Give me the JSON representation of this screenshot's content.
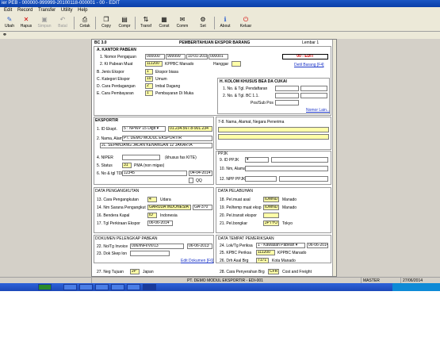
{
  "window": {
    "title": "ier PEB - 000000-999999-20100118-000001 - 00 - EDIT"
  },
  "menu": [
    "Edit",
    "Record",
    "Transfer",
    "Utility",
    "Help"
  ],
  "toolbar": [
    {
      "label": "Ubah",
      "icon": "✎"
    },
    {
      "label": "Hapus",
      "icon": "✕"
    },
    {
      "label": "Simpan",
      "icon": "▣"
    },
    {
      "label": "Batal",
      "icon": "↶"
    },
    {
      "label": "Cetak",
      "icon": "⎙"
    },
    {
      "label": "Copy",
      "icon": "❐"
    },
    {
      "label": "Compr",
      "icon": "▤"
    },
    {
      "label": "Transf",
      "icon": "⇅"
    },
    {
      "label": "Const",
      "icon": "▦"
    },
    {
      "label": "Comm",
      "icon": "✉"
    },
    {
      "label": "Set",
      "icon": "⚙"
    },
    {
      "label": "About",
      "icon": "ℹ"
    },
    {
      "label": "Keluar",
      "icon": "⏻"
    }
  ],
  "form": {
    "code": "BC 3.0",
    "header_title": "PEMBERITAHUAN EKSPOR BARANG",
    "sheet_label": "Lembar 1",
    "status": "00 - EDIT",
    "kantor_title": "A. KANTOR PABEAN",
    "nomor_label": "1. Nomor Pengajuan",
    "nomor": [
      "000000",
      "999999",
      "10-01-2010",
      "000001"
    ],
    "kantor_muat_label": "2. Kt Pabean Muat",
    "kantor_muat_code": "111200",
    "kantor_muat_name": "KPPBC Manado",
    "hanggar_label": "Hanggar",
    "detil_barang": "Detil Barang [F4]",
    "jenis_label": "B. Jenis Ekspor",
    "jenis_code": "1",
    "jenis_name": "Ekspor biasa",
    "kategori_label": "C. Kategori Ekspor",
    "kategori_code": "10",
    "kategori_name": "Umum",
    "perdagangan_label": "D. Cara Perdagangan",
    "perdagangan_code": "2",
    "perdagangan_name": "Imbal Dagang",
    "pembayaran_label": "E. Cara Pembayaran",
    "pembayaran_code": "1",
    "pembayaran_name": "Pembayaran Di Muka",
    "kolom_title": "H. KOLOM KHUSUS BEA DA CUKAI",
    "kolom_1": "1. No. & Tgl. Pendaftaran",
    "kolom_2": "2. No. & Tgl. BC 1.1.",
    "kolom_3": "Pos/Sub Pos",
    "nomor_lain": "Nomor Lain...",
    "eksportir_title": "EKSPORTIR",
    "id_label": "1. ID Ekspt.",
    "id_type": "5 : NPWP 15 Digit",
    "id_value": "01.234.567.8-901.234",
    "nama_label": "2. Nama, Alamat",
    "nama_value": "PT. DEMO MODUL EKSPORTIR",
    "alamat_value": "JL. SEPANJANG JALAN KENANGAN 12 JAKARTA",
    "nipier_label": "4. NIPER",
    "nipier_hint": "(khusus fas KITE)",
    "status_label": "5. Status",
    "status_code": "31",
    "status_name": "PMA (non migas)",
    "tdp_label": "6. No & tgl TDP",
    "tdp_value": "12345",
    "tdp_date": "04-04-2014",
    "qq_label": "QQ",
    "penerima_label": "7-8. Nama, Alamat, Negara Penerima",
    "ppjk_title": "PPJK",
    "ppjk_id_label": "9. ID PPJK",
    "ppjk_nama_label": "10. Nm, Alamat",
    "ppjk_npwp_label": "12. NPP PPJK",
    "angkut_title": "DATA PENGANGKUTAN",
    "cara_angkut_label": "13. Cara Pengangkutan",
    "cara_angkut_code": "4",
    "cara_angkut_name": "Udara",
    "sarana_label": "14. Nm Sarana Pengangkut",
    "sarana_name": "GARUDA INDONESIA",
    "sarana_no": "GA-370",
    "bendera_label": "16. Bendera Kapal",
    "bendera_code": "ID",
    "bendera_name": "Indonesia",
    "tgl_perkiraan_label": "17. Tgl Perkiraan Ekspor",
    "tgl_perkiraan": "06-06-2014",
    "pelabuhan_title": "DATA PELABUHAN",
    "muat_asal_label": "18. Pel.muat asal",
    "muat_asal_code": "IDMND",
    "muat_asal_name": "Manado",
    "muat_ekspor_label": "19. Pel/temp muat eksp",
    "muat_ekspor_code": "IDMND",
    "muat_ekspor_name": "Manado",
    "transit_label": "20. Pel.transit ekspor",
    "bongkar_label": "21. Pel.bongkar",
    "bongkar_code": "JPTYO",
    "bongkar_name": "Tokyo",
    "dokumen_title": "DOKUMEN PELENGKAP PABEAN",
    "invoice_label": "22. No/Tg Invoice",
    "invoice_no": "006/INFI/VII/13",
    "invoice_date": "06-06-2013",
    "skep_label": "23. Dok Skep lon",
    "edit_dokumen": "Edit Dokumen [F6]",
    "periksa_title": "DATA TEMPAT PEMERIKSAAN",
    "lok_label": "24. Lok/Tg Periksa",
    "lok_value": "1 - Kawasan Pabean",
    "lok_date": "06-06-2014",
    "kpbc_label": "25. KPBC Periksa",
    "kpbc_code": "111200",
    "kpbc_name": "KPPBC Manado",
    "daerah_label": "26. Drh Asal Brg",
    "daerah_code": "7171",
    "daerah_name": "Kota Manado",
    "negara_label": "27. Neg Tujuan",
    "negara_code": "JP",
    "negara_name": "Japan",
    "penyerahan_label": "28. Cara Penyerahan Brg",
    "penyerahan_code": "CFR",
    "penyerahan_name": "Cost and Freight"
  },
  "statusbar": {
    "company": "PT. DEMO MODUL EKSPORTIR - EDI-001",
    "user": "MASTER",
    "date": "27/06/2014"
  },
  "colors": {
    "titlebar": "#0a3ea8",
    "accent_red": "#d40000",
    "yellow_field": "#ffffa8",
    "taskbar": "#1b48b8"
  }
}
